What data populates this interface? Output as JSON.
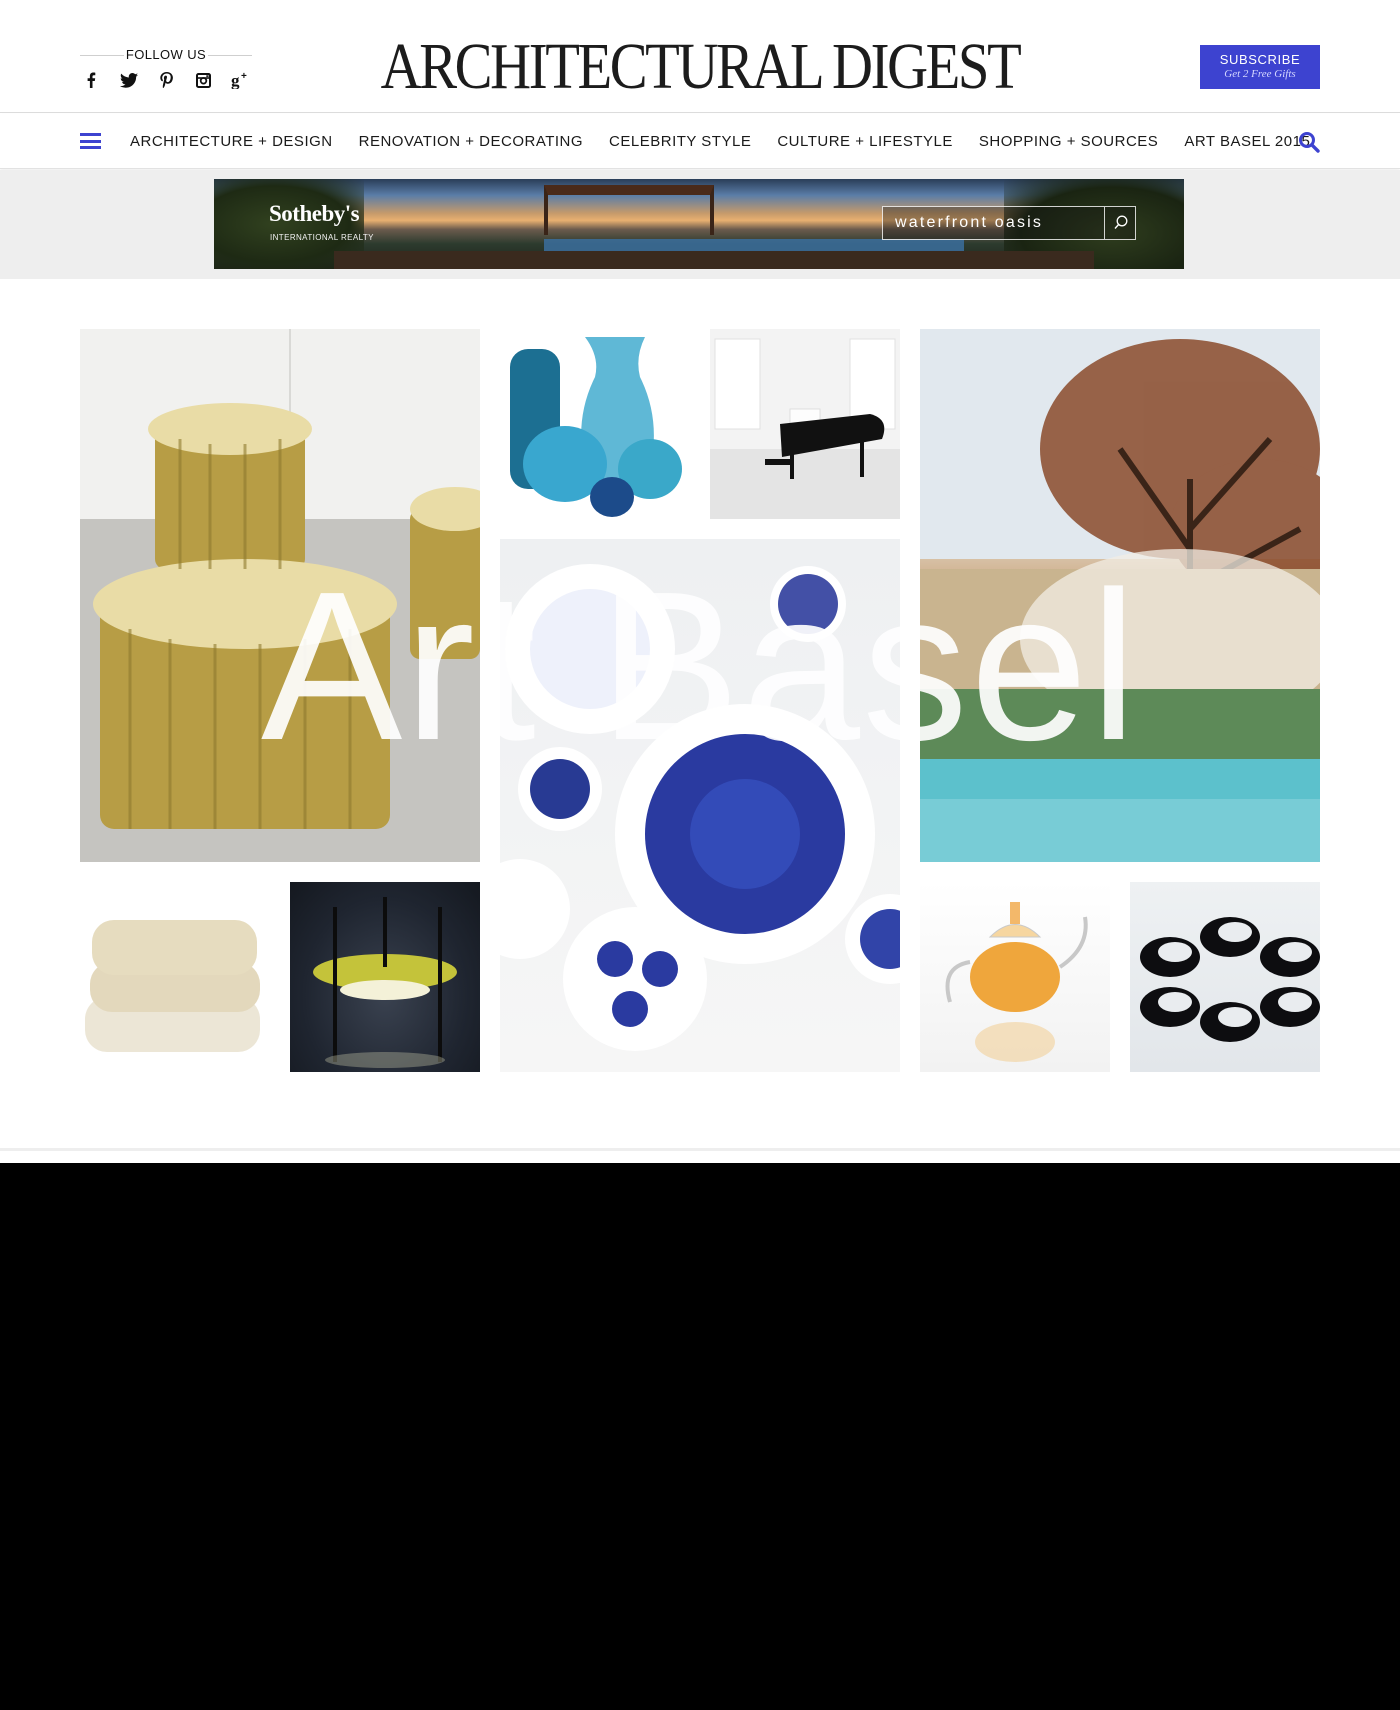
{
  "header": {
    "follow_label": "FOLLOW US",
    "social_icons": [
      "facebook-icon",
      "twitter-icon",
      "pinterest-icon",
      "instagram-icon",
      "google-plus-icon"
    ],
    "logo": "ARCHITECTURAL DIGEST",
    "subscribe_label": "SUBSCRIBE",
    "subscribe_sub": "Get 2 Free Gifts"
  },
  "nav": {
    "items": [
      "ARCHITECTURE + DESIGN",
      "RENOVATION + DECORATING",
      "CELEBRITY STYLE",
      "CULTURE + LIFESTYLE",
      "SHOPPING + SOURCES",
      "ART BASEL 2015"
    ],
    "menu_icon": "hamburger-menu-icon",
    "search_icon": "search-icon"
  },
  "ad": {
    "brand": "Sotheby's",
    "brand_sub": "INTERNATIONAL REALTY",
    "search_text": "waterfront oasis",
    "search_icon": "search-icon"
  },
  "hero": {
    "title": "Art Basel"
  },
  "colors": {
    "accent": "#3d43d0",
    "text": "#1a1a1a",
    "ad_band": "#eeeeee",
    "footer": "#000000"
  }
}
